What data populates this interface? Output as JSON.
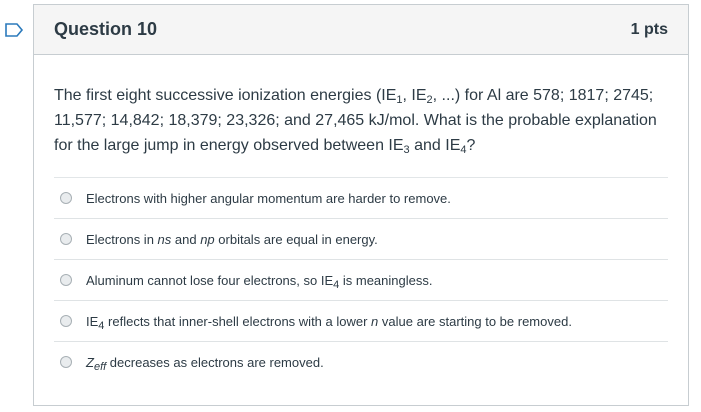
{
  "question": {
    "title": "Question 10",
    "points": "1 pts",
    "text": {
      "p1": "The first eight successive ionization energies (IE",
      "sub1": "1",
      "p2": ", IE",
      "sub2": "2",
      "p3": ", ...) for Al are 578; 1817; 2745; 11,577; 14,842; 18,379; 23,326; and 27,465 kJ/mol. What is the probable explanation for the large jump in energy observed between IE",
      "sub3": "3",
      "p4": " and IE",
      "sub4": "4",
      "p5": "?"
    }
  },
  "answers": {
    "a1": {
      "text": "Electrons with higher angular momentum are harder to remove."
    },
    "a2": {
      "p1": "Electrons in ",
      "ns": "ns",
      "p2": " and ",
      "np": "np",
      "p3": " orbitals are equal in energy."
    },
    "a3": {
      "p1": "Aluminum cannot lose four electrons, so IE",
      "sub": "4",
      "p2": " is meaningless."
    },
    "a4": {
      "p1": "IE",
      "sub": "4",
      "p2": " reflects that inner-shell electrons with a lower ",
      "n": "n",
      "p3": " value are starting to be removed."
    },
    "a5": {
      "z": "Z",
      "sub": "eff",
      "p1": " decreases as electrons are removed."
    }
  },
  "colors": {
    "flag": "#2b7abc",
    "border": "#c7cdd1",
    "header_bg": "#f5f5f5"
  },
  "icons": {
    "flag": "flag-icon"
  }
}
